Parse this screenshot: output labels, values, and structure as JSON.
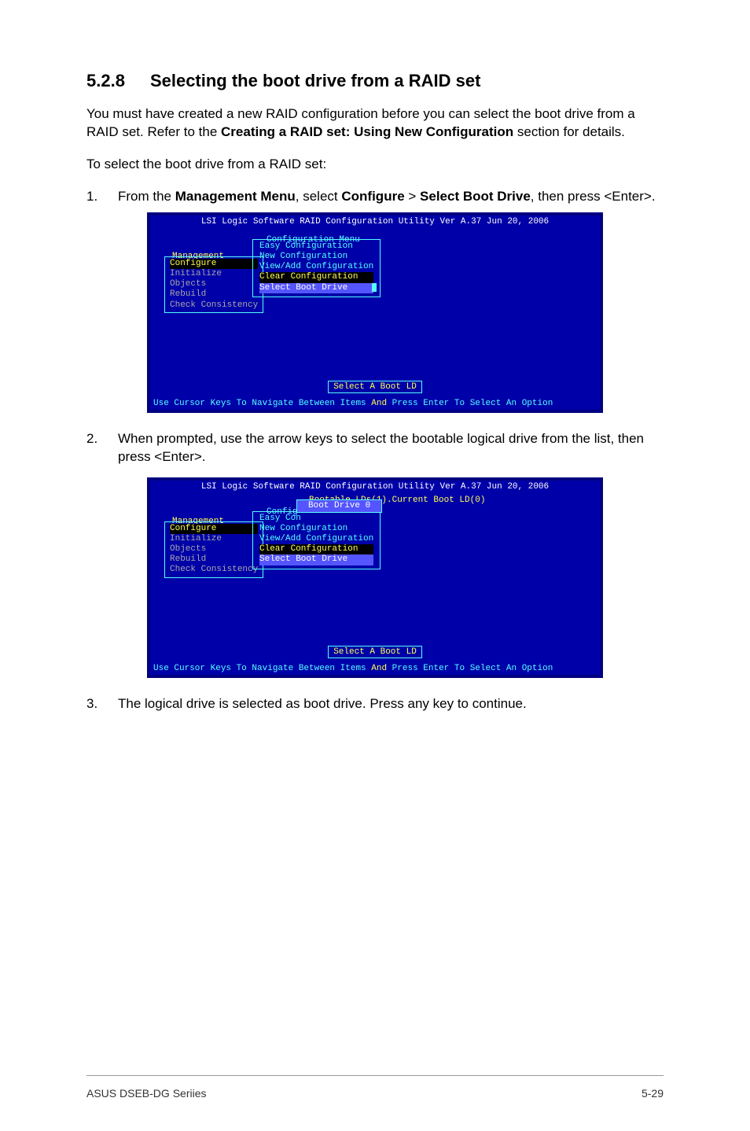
{
  "heading": {
    "number": "5.2.8",
    "title": "Selecting the boot drive from a RAID set"
  },
  "para1_a": "You must have created a new RAID configuration before you can select the boot drive from a RAID set. Refer to the ",
  "para1_bold": "Creating a RAID set: Using New Configuration",
  "para1_b": " section for details.",
  "para2": "To select the boot drive from a RAID set:",
  "steps": {
    "s1num": "1.",
    "s1a": "From the ",
    "s1b": "Management Menu",
    "s1c": ", select ",
    "s1d": "Configure",
    "s1e": " > ",
    "s1f": "Select Boot Drive",
    "s1g": ", then press <Enter>.",
    "s2num": "2.",
    "s2": "When prompted, use the arrow keys to select the bootable logical drive from the list, then press <Enter>.",
    "s3num": "3.",
    "s3": "The logical drive is selected as boot drive. Press any key to continue."
  },
  "bios": {
    "title": "LSI Logic Software RAID Configuration Utility Ver A.37 Jun 20, 2006",
    "mgmt_label": "Management",
    "mgmt_items": {
      "configure": "Configure",
      "initialize": "Initialize",
      "objects": "Objects",
      "rebuild": "Rebuild",
      "check": "Check Consistency"
    },
    "cfg_label": "Configuration Menu",
    "cfg_items": {
      "easy": "Easy Configuration",
      "new": "New Configuration",
      "view": "View/Add Configuration",
      "clear": "Clear Configuration",
      "select": "Select Boot Drive"
    },
    "cfg_label2": "Config",
    "easy2": "Easy Con",
    "bootable_label": "Bootable LDs(1).Current Boot LD(0)",
    "boot_item": "Boot Drive 0",
    "hint": "Select A Boot LD",
    "status_a": "Use Cursor Keys To Navigate Between Items",
    "status_b": " And ",
    "status_c": "Press Enter To Select An Option"
  },
  "footer": {
    "left": "ASUS DSEB-DG Seriies",
    "right": "5-29"
  }
}
